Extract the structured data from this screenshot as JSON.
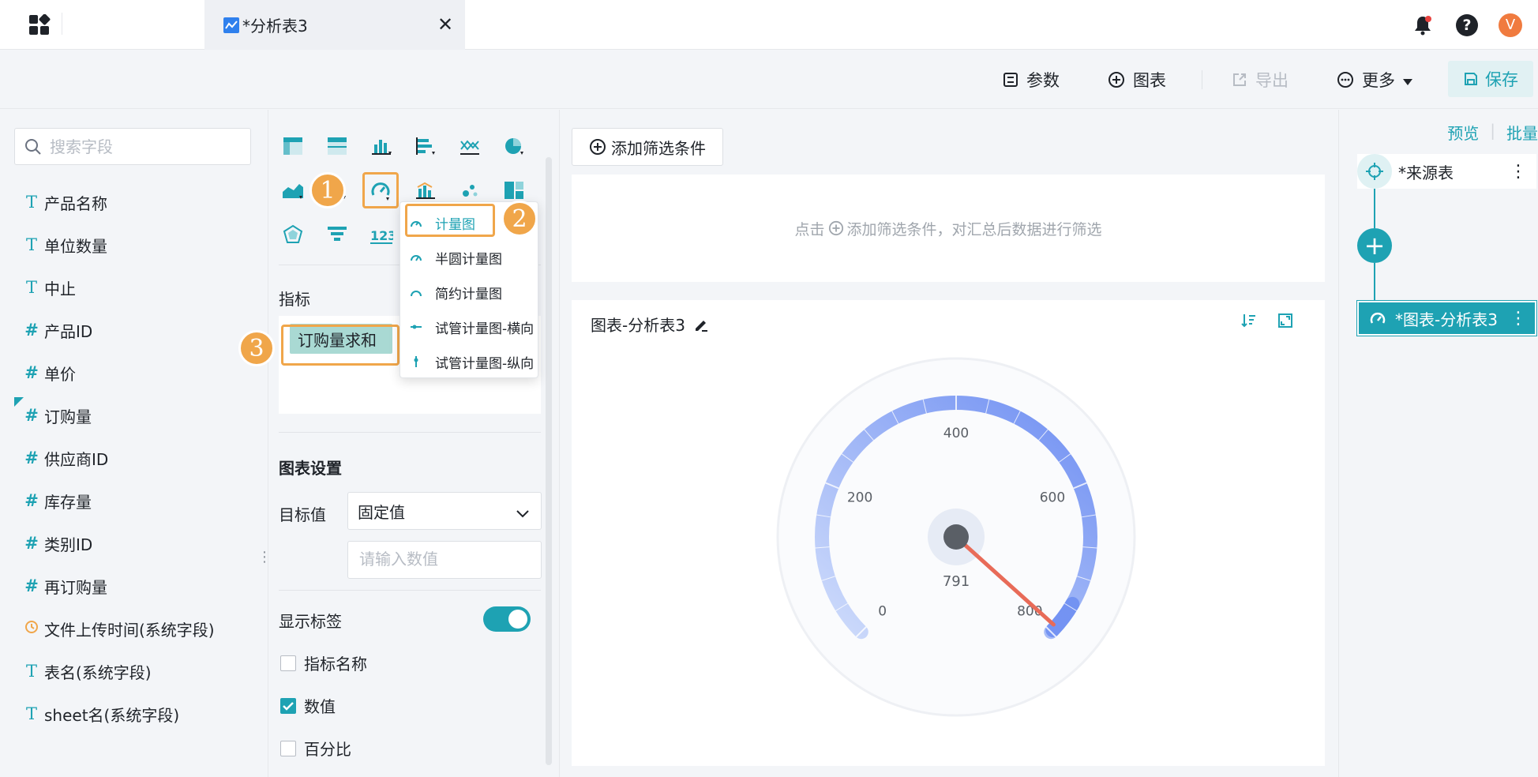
{
  "tab": {
    "title": "*分析表3",
    "close": "✕"
  },
  "user": {
    "avatar_letter": "V"
  },
  "toolbar": {
    "params": "参数",
    "chart": "图表",
    "export": "导出",
    "more": "更多",
    "save": "保存"
  },
  "left": {
    "search_placeholder": "搜索字段",
    "fields": [
      {
        "type": "T",
        "name": "产品名称"
      },
      {
        "type": "T",
        "name": "单位数量"
      },
      {
        "type": "T",
        "name": "中止"
      },
      {
        "type": "#",
        "name": "产品ID"
      },
      {
        "type": "#",
        "name": "单价"
      },
      {
        "type": "#",
        "name": "订购量"
      },
      {
        "type": "#",
        "name": "供应商ID"
      },
      {
        "type": "#",
        "name": "库存量"
      },
      {
        "type": "#",
        "name": "类别ID"
      },
      {
        "type": "#",
        "name": "再订购量"
      },
      {
        "type": "clock",
        "name": "文件上传时间(系统字段)"
      },
      {
        "type": "T",
        "name": "表名(系统字段)"
      },
      {
        "type": "T",
        "name": "sheet名(系统字段)"
      }
    ]
  },
  "config": {
    "metric_label": "指标",
    "metric_tag": "订购量求和",
    "chart_settings_title": "图表设置",
    "target_label": "目标值",
    "target_select": "固定值",
    "target_input_placeholder": "请输入数值",
    "show_labels": "显示标签",
    "cb_metric_name": "指标名称",
    "cb_value": "数值",
    "cb_percent": "百分比"
  },
  "dropdown": {
    "items": [
      "计量图",
      "半圆计量图",
      "简约计量图",
      "试管计量图-横向",
      "试管计量图-纵向"
    ]
  },
  "badges": [
    "1",
    "2",
    "3"
  ],
  "main": {
    "add_filter": "添加筛选条件",
    "filter_hint_pre": "点击",
    "filter_hint_post": "添加筛选条件，对汇总后数据进行筛选",
    "chart_title": "图表-分析表3",
    "gauge": {
      "value": 791,
      "value_label": "791",
      "min": 0,
      "max": 800,
      "ticks": [
        "0",
        "200",
        "400",
        "600",
        "800"
      ],
      "colors": {
        "start": "#cfdcfb",
        "end": "#6f8ff2",
        "needle": "#e86b58"
      }
    }
  },
  "right": {
    "preview": "预览",
    "batch": "批量",
    "source_node": "*来源表",
    "chart_node": "*图表-分析表3"
  }
}
